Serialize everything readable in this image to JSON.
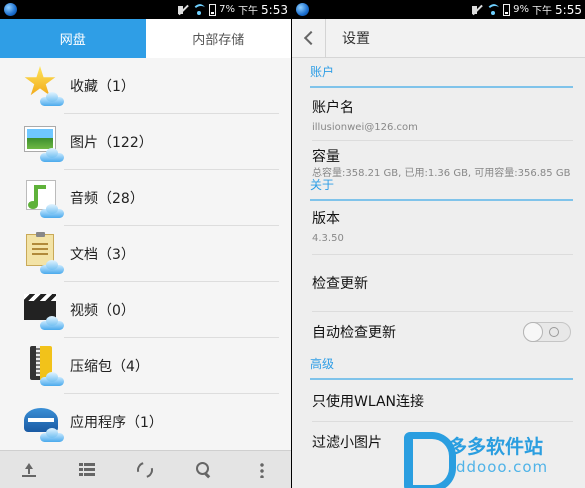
{
  "left_screen": {
    "status": {
      "battery": "7%",
      "ampm": "下午",
      "time": "5:53"
    },
    "tabs": [
      {
        "label": "网盘",
        "active": true
      },
      {
        "label": "内部存储",
        "active": false
      }
    ],
    "categories": [
      {
        "label": "收藏（1）",
        "icon": "star-cloud-icon"
      },
      {
        "label": "图片（122）",
        "icon": "photo-cloud-icon"
      },
      {
        "label": "音频（28）",
        "icon": "music-cloud-icon"
      },
      {
        "label": "文档（3）",
        "icon": "document-cloud-icon"
      },
      {
        "label": "视频（0）",
        "icon": "video-cloud-icon"
      },
      {
        "label": "压缩包（4）",
        "icon": "archive-cloud-icon"
      },
      {
        "label": "应用程序（1）",
        "icon": "app-cloud-icon"
      }
    ],
    "bottom_actions": [
      "upload-icon",
      "grid-icon",
      "refresh-icon",
      "search-icon",
      "more-icon"
    ]
  },
  "right_screen": {
    "status": {
      "battery": "9%",
      "ampm": "下午",
      "time": "5:55"
    },
    "header": {
      "title": "设置"
    },
    "sections": {
      "account": {
        "title": "账户",
        "account_name": {
          "title": "账户名",
          "value": "illusionwei@126.com"
        },
        "capacity": {
          "title": "容量",
          "value": "总容量:358.21 GB, 已用:1.36 GB, 可用容量:356.85 GB"
        }
      },
      "about": {
        "title": "关于",
        "version": {
          "title": "版本",
          "value": "4.3.50"
        },
        "check_update": {
          "title": "检查更新"
        },
        "auto_check": {
          "title": "自动检查更新",
          "enabled": false
        }
      },
      "advanced": {
        "title": "高级",
        "wlan_only": {
          "title": "只使用WLAN连接"
        },
        "filter_small": {
          "title": "过滤小图片"
        }
      }
    }
  },
  "watermark": {
    "cn": "多多软件站",
    "en": "ddooo.com",
    "color": "#2a9ee0"
  },
  "accent_color": "#2f9ee6"
}
